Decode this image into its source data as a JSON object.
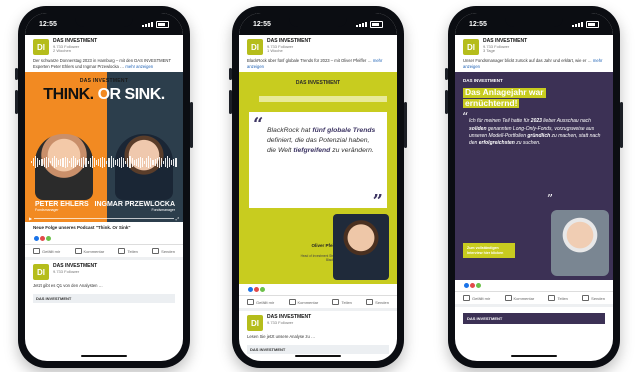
{
  "phones": [
    {
      "status_time": "12:55",
      "post": {
        "logo": "DI",
        "author": "DAS INVESTMENT",
        "meta": "9.733 Follower",
        "meta2": "2 Wochen",
        "text": "Der schwarze Donnerstag 2023 in Hamburg – mit den DAS INVESTMENT Experten Peter Ehlers und Ingmar Przewlocka …",
        "link_text": "mehr anzeigen"
      },
      "graphic": {
        "brand": "DAS INVESTMENT",
        "title_a": "THINK.",
        "title_b": "OR SINK.",
        "person1_name": "PETER EHLERS",
        "person1_sub": "Fondsmanager",
        "person2_name": "INGMAR PRZEWLOCKA",
        "person2_sub": "Fondsmanager"
      },
      "caption": "Neue Folge unseres Podcast \"Think. Or Sink\"",
      "actions": [
        "Gefällt mir",
        "Kommentar",
        "Teilen",
        "Senden"
      ],
      "post2": {
        "logo": "DI",
        "author": "DAS INVESTMENT",
        "meta": "9.733 Follower",
        "text": "Jetzt gibt es Q1 von den Analysten …",
        "banner": "DAS INVESTMENT"
      }
    },
    {
      "status_time": "12:55",
      "post": {
        "logo": "DI",
        "author": "DAS INVESTMENT",
        "meta": "9.733 Follower",
        "meta2": "1 Woche",
        "text": "BlackRock über fünf globale Trends für 2023 – mit Oliver Pfeiffer …",
        "link_text": "mehr anzeigen"
      },
      "graphic": {
        "brand": "DAS INVESTMENT",
        "quote_pre": "BlackRock hat ",
        "quote_b1": "fünf globale Trends",
        "quote_mid": " definiert, die das Potenzial haben, die Welt ",
        "quote_b2": "tiefgreifend",
        "quote_post": " zu verändern.",
        "person_name": "Oliver Pfeiffer",
        "person_role": "Head of Investment Strategy BlackRock"
      },
      "actions": [
        "Gefällt mir",
        "Kommentar",
        "Teilen",
        "Senden"
      ],
      "post2": {
        "logo": "DI",
        "author": "DAS INVESTMENT",
        "meta": "9.733 Follower",
        "text": "Lesen Sie jetzt unsere Analyse zu …",
        "banner": "DAS INVESTMENT"
      }
    },
    {
      "status_time": "12:55",
      "post": {
        "logo": "DI",
        "author": "DAS INVESTMENT",
        "meta": "9.733 Follower",
        "meta2": "3 Tage",
        "text": "Unser Fondsmanager blickt zurück auf das Jahr und erklärt, wie er …",
        "link_text": "mehr anzeigen"
      },
      "graphic": {
        "brand": "DAS INVESTMENT",
        "headline_1": "Das Anlagejahr war",
        "headline_2": "ernüchternd!",
        "quote_a": "Ich für meinen Teil hatte für ",
        "quote_b1": "2023",
        "quote_c": " lieber Ausschau nach ",
        "quote_b2": "soliden",
        "quote_d": " genannten Long-Only-Fonds, vorzugsweise aus ",
        "quote_e": "unseren Modell-Portfolien ",
        "quote_b3": "gründlich",
        "quote_f": " zu machen, statt nach den ",
        "quote_b4": "erfolgreichsten",
        "quote_g": " zu suchen.",
        "cta": "Zum vollständigen Interview hier klicken"
      },
      "actions": [
        "Gefällt mir",
        "Kommentar",
        "Teilen",
        "Senden"
      ],
      "post2": {
        "banner": "DAS INVESTMENT"
      }
    }
  ]
}
